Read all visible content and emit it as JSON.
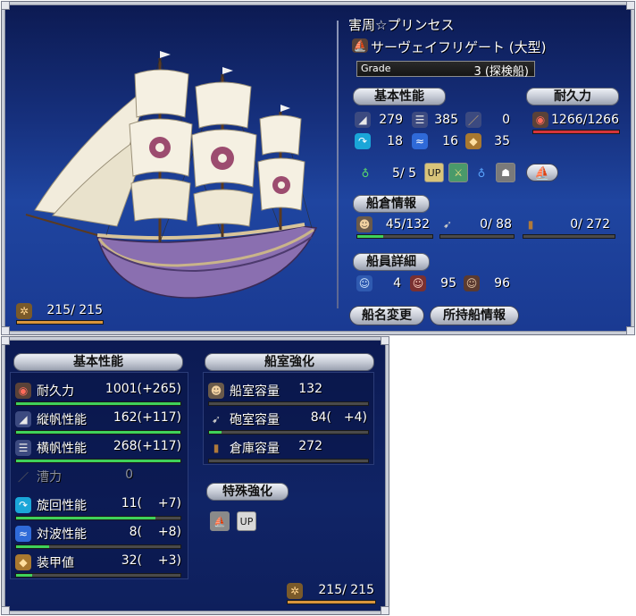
{
  "header": {
    "captain_name": "害周☆プリンセス",
    "ship_type": "サーヴェイフリゲート (大型)",
    "grade_label": "Grade",
    "grade_value": "3 (探検船)"
  },
  "basic": {
    "title": "基本性能",
    "rows": [
      {
        "icon": "vertical-sail-icon",
        "value": "279"
      },
      {
        "icon": "horizontal-sail-icon",
        "value": "385"
      },
      {
        "icon": "oar-icon",
        "value": "0"
      },
      {
        "icon": "turn-icon",
        "value": "18"
      },
      {
        "icon": "wave-icon",
        "value": "16"
      },
      {
        "icon": "armor-icon",
        "value": "35"
      }
    ],
    "potion_value": "5/ 5"
  },
  "durability": {
    "title": "耐久力",
    "value": "1266/1266",
    "fill": 1.0
  },
  "cargo": {
    "title": "船倉情報",
    "crew": "45/132",
    "cannon": "0/ 88",
    "storage": "0/ 272",
    "crew_fill": 0.34
  },
  "crew": {
    "title": "船員詳細",
    "sailors": "4",
    "gunners": "95",
    "fighters": "96"
  },
  "left_bottom": {
    "supply": "215/ 215",
    "supply_fill": 1.0
  },
  "buttons": {
    "rename": "船名変更",
    "owned_info": "所持船情報"
  },
  "detail": {
    "basic_title": "基本性能",
    "rows": [
      {
        "label": "耐久力",
        "value": "1001(",
        "bonus": "+265)",
        "fill": 1.0,
        "icon": "durability-icon",
        "dim": false
      },
      {
        "label": "縦帆性能",
        "value": "162(",
        "bonus": "+117)",
        "fill": 1.0,
        "icon": "vertical-sail-icon",
        "dim": false
      },
      {
        "label": "横帆性能",
        "value": "268(",
        "bonus": "+117)",
        "fill": 1.0,
        "icon": "horizontal-sail-icon",
        "dim": false
      },
      {
        "label": "漕力",
        "value": "0",
        "bonus": "",
        "fill": 0.0,
        "icon": "oar-icon",
        "dim": true
      },
      {
        "label": "旋回性能",
        "value": "11(",
        "bonus": "+7)",
        "fill": 0.85,
        "icon": "turn-icon",
        "dim": false
      },
      {
        "label": "対波性能",
        "value": "8(",
        "bonus": "+8)",
        "fill": 0.2,
        "icon": "wave-icon",
        "dim": false
      },
      {
        "label": "装甲値",
        "value": "32(",
        "bonus": "+3)",
        "fill": 0.1,
        "icon": "armor-icon",
        "dim": false
      }
    ],
    "cabin_title": "船室強化",
    "cabin_rows": [
      {
        "label": "船室容量",
        "value": "132",
        "bonus": "",
        "icon": "crew-icon"
      },
      {
        "label": "砲室容量",
        "value": "84(",
        "bonus": "+4)",
        "icon": "cannon-icon"
      },
      {
        "label": "倉庫容量",
        "value": "272",
        "bonus": "",
        "icon": "barrel-icon"
      }
    ],
    "special_title": "特殊強化",
    "supply": "215/ 215"
  },
  "colors": {
    "bar_green": "#3fd25a",
    "bar_red": "#d6343a",
    "bar_orange": "#d9953c"
  }
}
